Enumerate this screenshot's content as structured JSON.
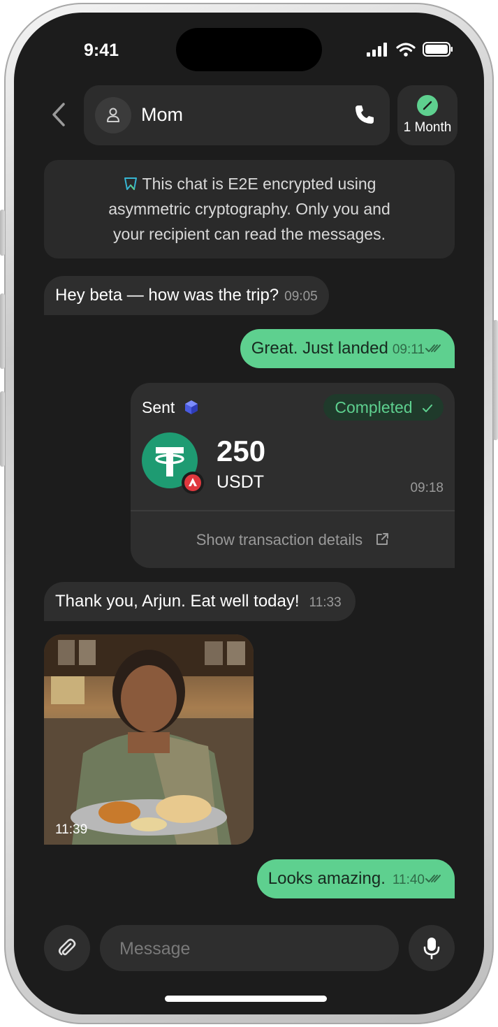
{
  "status_bar": {
    "time": "9:41"
  },
  "header": {
    "contact_name": "Mom",
    "timer_label": "1 Month"
  },
  "encryption_notice": {
    "line1": "This chat is E2E encrypted using",
    "line2": "asymmetric cryptography. Only you and",
    "line3": "your recipient can read the messages."
  },
  "messages": [
    {
      "direction": "in",
      "text": "Hey beta — how was the trip?",
      "time": "09:05"
    },
    {
      "direction": "out",
      "text": "Great. Just landed",
      "time": "09:11"
    },
    {
      "direction": "in",
      "text": "Thank you, Arjun. Eat well today!",
      "time": "11:33"
    },
    {
      "direction": "out",
      "text": "Looks amazing.",
      "time": "11:40"
    }
  ],
  "transaction": {
    "label": "Sent",
    "status": "Completed",
    "amount": "250",
    "unit": "USDT",
    "time": "09:18",
    "details_link": "Show transaction details"
  },
  "photo_message": {
    "time": "11:39"
  },
  "composer": {
    "placeholder": "Message"
  },
  "colors": {
    "accent": "#5ed08f",
    "background": "#1c1c1c",
    "bubble": "#2e2e2e",
    "token": "#1e9b72",
    "chain": "#e0383e"
  }
}
